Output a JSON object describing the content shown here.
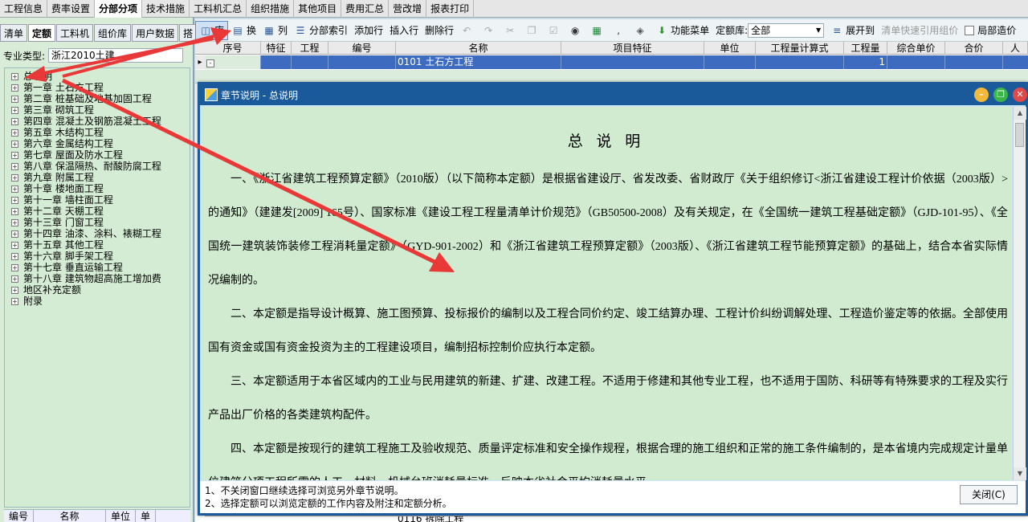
{
  "top_tabs": [
    "工程信息",
    "费率设置",
    "分部分项",
    "技术措施",
    "工料机汇总",
    "组织措施",
    "其他项目",
    "费用汇总",
    "营改增",
    "报表打印"
  ],
  "left_tabs": [
    "清单",
    "定额",
    "工料机",
    "组价库",
    "用户数据",
    "搭"
  ],
  "profession": {
    "label": "专业类型:",
    "value": "浙江2010土建"
  },
  "tree": [
    "总说明",
    "第一章 土石方工程",
    "第二章 桩基础及地基加固工程",
    "第三章 砌筑工程",
    "第四章 混凝土及钢筋混凝土工程",
    "第五章 木结构工程",
    "第六章 金属结构工程",
    "第七章 屋面及防水工程",
    "第八章 保温隔热、耐酸防腐工程",
    "第九章 附属工程",
    "第十章 楼地面工程",
    "第十一章 墙柱面工程",
    "第十二章 天棚工程",
    "第十三章 门窗工程",
    "第十四章 油漆、涂料、裱糊工程",
    "第十五章 其他工程",
    "第十六章 脚手架工程",
    "第十七章 垂直运输工程",
    "第十八章 建筑物超高施工增加费",
    "地区补充定额",
    "附录"
  ],
  "left_bottom_headers": [
    "编号",
    "名称",
    "单位",
    "单"
  ],
  "toolbar": {
    "lib": "库",
    "swap": "换",
    "col": "列",
    "section_index": "分部索引",
    "add_row": "添加行",
    "insert_row": "插入行",
    "delete_row": "删除行",
    "func_menu": "功能菜单",
    "quota_lib_label": "定额库:",
    "quota_lib_value": "全部",
    "expand_to": "展开到",
    "quick_ref": "清单快速引用组价",
    "local_price": "局部造价"
  },
  "grid": {
    "headers": [
      "序号",
      "特征",
      "工程",
      "编号",
      "名称",
      "项目特征",
      "单位",
      "工程量计算式",
      "工程量",
      "综合单价",
      "合价",
      "人"
    ],
    "row1": {
      "code": "0101",
      "name": "土石方工程",
      "qty": "1"
    },
    "bottom_row": "0116 拆除工程"
  },
  "dialog": {
    "title": "章节说明 - 总说明",
    "doc_title": "总 说 明",
    "paragraphs": [
      "一、《浙江省建筑工程预算定额》（2010版）（以下简称本定额）是根据省建设厅、省发改委、省财政厅《关于组织修订<浙江省建设工程计价依据（2003版）>的通知》（建建发[2009] 165号）、国家标准《建设工程工程量清单计价规范》（GB50500-2008）及有关规定，在《全国统一建筑工程基础定额》（GJD-101-95）、《全国统一建筑装饰装修工程消耗量定额》（GYD-901-2002）和《浙江省建筑工程预算定额》（2003版）、《浙江省建筑工程节能预算定额》的基础上，结合本省实际情况编制的。",
      "二、本定额是指导设计概算、施工图预算、投标报价的编制以及工程合同价约定、竣工结算办理、工程计价纠纷调解处理、工程造价鉴定等的依据。全部使用国有资金或国有资金投资为主的工程建设项目，编制招标控制价应执行本定额。",
      "三、本定额适用于本省区域内的工业与民用建筑的新建、扩建、改建工程。不适用于修建和其他专业工程，也不适用于国防、科研等有特殊要求的工程及实行产品出厂价格的各类建筑构配件。",
      "四、本定额是按现行的建筑工程施工及验收规范、质量评定标准和安全操作规程，根据合理的施工组织和正常的施工条件编制的，是本省境内完成规定计量单位建筑分项工程所需的人工、材料、机械台班消耗量标准，反映本省社会平均消耗量水平。"
    ],
    "hints": [
      "1、不关闭窗口继续选择可浏览另外章节说明。",
      "2、选择定额可以浏览定额的工作内容及附注和定额分析。"
    ],
    "close_label": "关闭(C)"
  },
  "colors": {
    "accent": "#1a5a9a",
    "selected_row": "#3d6bbf",
    "content_bg": "#d0ebd0",
    "arrow": "#e83838"
  }
}
